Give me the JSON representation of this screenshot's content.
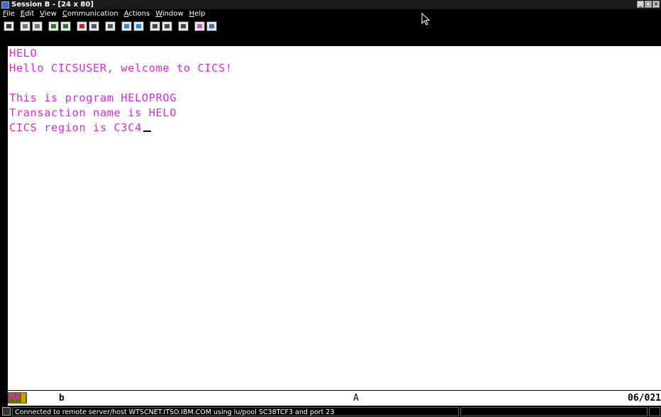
{
  "window": {
    "title": "Session B - [24 x 80]",
    "buttons": {
      "minimize": "_",
      "maximize": "□",
      "close": "×"
    }
  },
  "menubar": {
    "items": [
      {
        "label": "File",
        "mnemonic": "F"
      },
      {
        "label": "Edit",
        "mnemonic": "E"
      },
      {
        "label": "View",
        "mnemonic": "V"
      },
      {
        "label": "Communication",
        "mnemonic": "C"
      },
      {
        "label": "Actions",
        "mnemonic": "A"
      },
      {
        "label": "Window",
        "mnemonic": "W"
      },
      {
        "label": "Help",
        "mnemonic": "H"
      }
    ]
  },
  "toolbar": {
    "icons": [
      "print-screen-icon",
      "copy-icon",
      "paste-icon",
      "send-file-icon",
      "receive-file-icon",
      "display-keypad-icon",
      "record-macro-icon",
      "play-macro-icon",
      "connect-icon",
      "disconnect-icon",
      "batch-connect-icon",
      "batch-disconnect-icon",
      "customize-icon",
      "color-palette-icon",
      "edit-icon"
    ]
  },
  "terminal": {
    "text_color": "#d92bd9",
    "lines": [
      "HELO",
      "Hello CICSUSER, welcome to CICS!",
      "",
      "This is program HELOPROG",
      "Transaction name is HELO",
      "CICS region is C3C4"
    ]
  },
  "oia": {
    "indicator": "MA",
    "mode": "b",
    "field": "A",
    "cursor_position": "06/021"
  },
  "statusbar": {
    "message": "Connected to remote server/host WTSCNET.ITSO.IBM.COM using lu/pool SC38TCF3 and port 23"
  }
}
